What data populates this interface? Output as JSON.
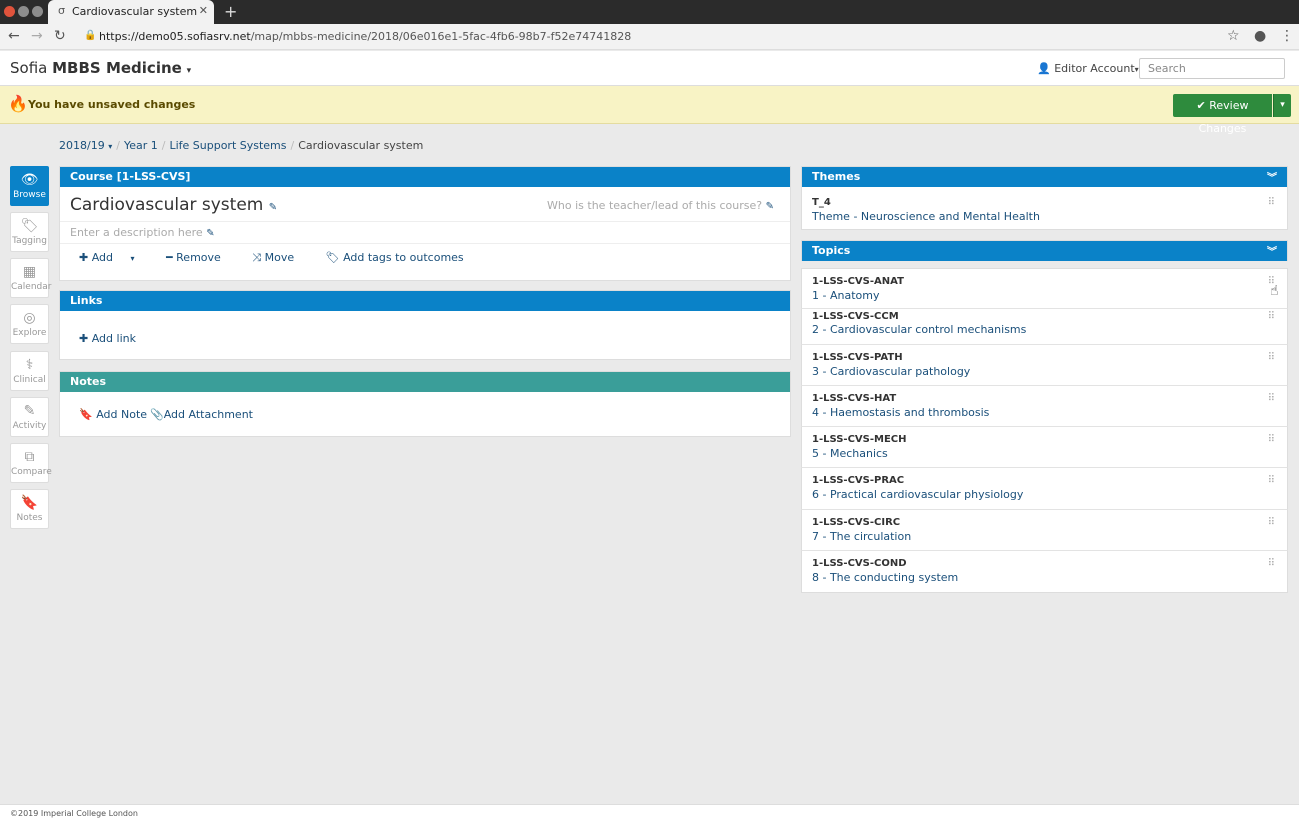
{
  "browser": {
    "tab_title": "Cardiovascular system | C",
    "favicon": "σ",
    "url_host": "https://demo05.sofiasrv.net",
    "url_path": "/map/mbbs-medicine/2018/06e016e1-5fac-4fb6-98b7-f52e74741828"
  },
  "header": {
    "brand_prefix": "Sofia",
    "brand_name": "MBBS Medicine",
    "account": "Editor Account",
    "search_placeholder": "Search"
  },
  "banner": {
    "text": "You have unsaved changes",
    "review_button": "Review Changes"
  },
  "breadcrumb": {
    "year": "2018/19",
    "level": "Year 1",
    "module": "Life Support Systems",
    "current": "Cardiovascular system"
  },
  "sidenav": [
    {
      "icon": "👁",
      "label": "Browse",
      "active": true
    },
    {
      "icon": "🏷",
      "label": "Tagging"
    },
    {
      "icon": "▦",
      "label": "Calendar"
    },
    {
      "icon": "◎",
      "label": "Explore"
    },
    {
      "icon": "⚕",
      "label": "Clinical"
    },
    {
      "icon": "✎",
      "label": "Activity"
    },
    {
      "icon": "⧉",
      "label": "Compare"
    },
    {
      "icon": "🔖",
      "label": "Notes"
    }
  ],
  "course": {
    "header": "Course [1-LSS-CVS]",
    "title": "Cardiovascular system",
    "teacher_placeholder": "Who is the teacher/lead of this course?",
    "description_placeholder": "Enter a description here",
    "actions": {
      "add": "Add",
      "remove": "Remove",
      "move": "Move",
      "tags": "Add tags to outcomes"
    }
  },
  "links": {
    "header": "Links",
    "add_link": "Add link"
  },
  "notes": {
    "header": "Notes",
    "add_note": "Add Note",
    "add_attachment": "Add Attachment"
  },
  "themes": {
    "header": "Themes",
    "items": [
      {
        "code": "T_4",
        "name": "Theme - Neuroscience and Mental Health"
      }
    ]
  },
  "topics": {
    "header": "Topics",
    "items": [
      {
        "code": "1-LSS-CVS-ANAT",
        "name": "1 - Anatomy"
      },
      {
        "code": "1-LSS-CVS-CCM",
        "name": "2 - Cardiovascular control mechanisms"
      },
      {
        "code": "1-LSS-CVS-PATH",
        "name": "3 - Cardiovascular pathology"
      },
      {
        "code": "1-LSS-CVS-HAT",
        "name": "4 - Haemostasis and thrombosis"
      },
      {
        "code": "1-LSS-CVS-MECH",
        "name": "5 - Mechanics"
      },
      {
        "code": "1-LSS-CVS-PRAC",
        "name": "6 - Practical cardiovascular physiology"
      },
      {
        "code": "1-LSS-CVS-CIRC",
        "name": "7 - The circulation"
      },
      {
        "code": "1-LSS-CVS-COND",
        "name": "8 - The conducting system"
      }
    ]
  },
  "footer": "©2019 Imperial College London"
}
